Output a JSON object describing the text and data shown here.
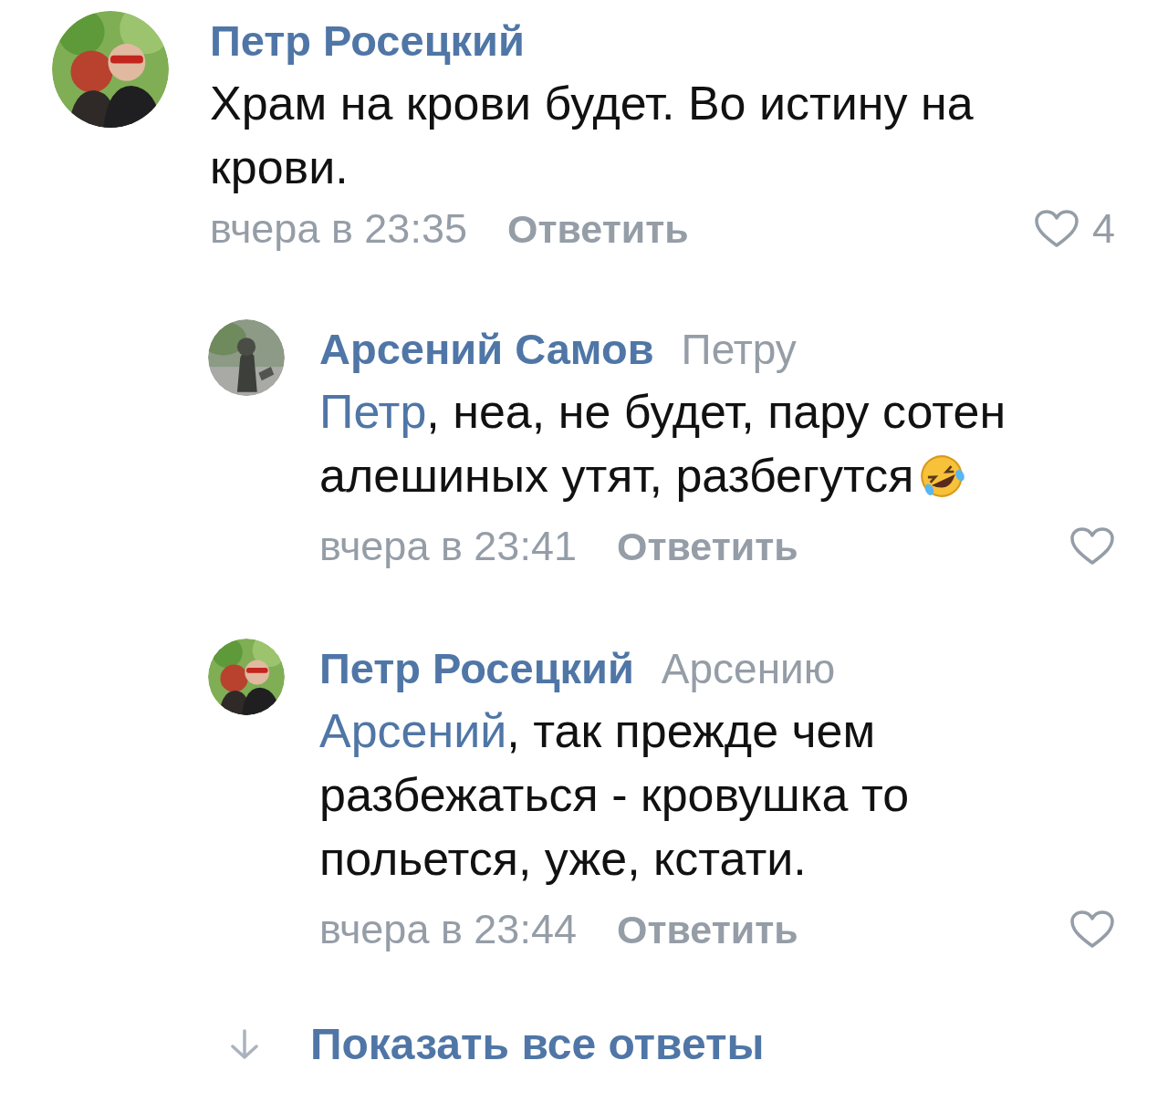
{
  "comment": {
    "author": "Петр Росецкий",
    "text": "Храм на крови будет. Во истину на крови.",
    "time": "вчера в 23:35",
    "reply_action": "Ответить",
    "likes": "4"
  },
  "replies": [
    {
      "author": "Арсений Самов",
      "reply_to": "Петру",
      "mention": "Петр",
      "text": ", неа, не будет, пару сотен алешиных утят, разбегутся",
      "emoji": true,
      "time": "вчера в 23:41",
      "reply_action": "Ответить"
    },
    {
      "author": "Петр Росецкий",
      "reply_to": "Арсению",
      "mention": "Арсений",
      "text": ", так прежде чем разбежаться - кровушка то польется, уже, кстати.",
      "emoji": false,
      "time": "вчера в 23:44",
      "reply_action": "Ответить"
    }
  ],
  "show_all": "Показать все ответы"
}
